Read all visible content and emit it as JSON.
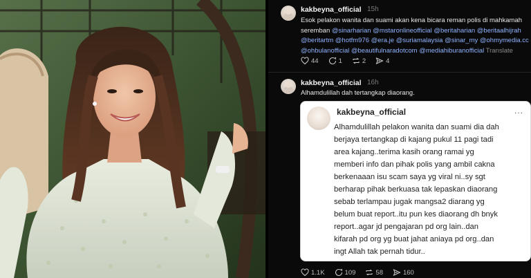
{
  "photo": {
    "alt": ""
  },
  "post1": {
    "username": "kakbeyna_official",
    "time": "15h",
    "text_lines": [
      "Esok pelakon wanita dan suami akan kena bicara reman polis di mahkamah",
      "seremban"
    ],
    "mentions_line1": "@sinarharian @mstaronlineofficial @beritaharian @beritaalhijrah",
    "mentions_line2": "@beritartm @hotfm976 @era.je @suriamalaysia @sinar_my @ohmymedia.cc",
    "mentions_line3": "@ohbulanofficial @beautifulnaradotcom @mediahiburanofficial",
    "translate": "Translate",
    "likes": "44",
    "comments": "1",
    "reposts": "2",
    "shares": "4"
  },
  "post2": {
    "username": "kakbeyna_official",
    "time": "16h",
    "text": "Alhamdulillah dah tertangkap diaorang.",
    "likes": "1.1K",
    "comments": "109",
    "reposts": "58",
    "shares": "160",
    "quoted": {
      "username": "kakbeyna_official",
      "more": "...",
      "lines": [
        "Alhamdulillah pelakon wanita dan suami dia dah",
        "berjaya tertangkap di kajang pukul 11 pagi tadi",
        "area kajang..terima kasih orang ramai yg",
        "memberi info dan pihak polis yang ambil cakna",
        "berkenaaan isu scam saya yg viral ni..sy sgt",
        "berharap pihak berkuasa tak lepaskan diaorang",
        "sebab terlampau jugak mangsa2 diarang yg",
        "belum buat report..itu pun kes diaorang dh bnyk",
        "report..agar jd pengajaran pd org lain..dan",
        "kifarah pd org yg buat jahat aniaya pd org..dan",
        "ingt Allah tak pernah tidur.."
      ]
    }
  },
  "colors": {
    "background": "#0a0a0a",
    "link": "#8fb3ff",
    "muted": "#7b7b7b",
    "card": "#ffffff"
  }
}
